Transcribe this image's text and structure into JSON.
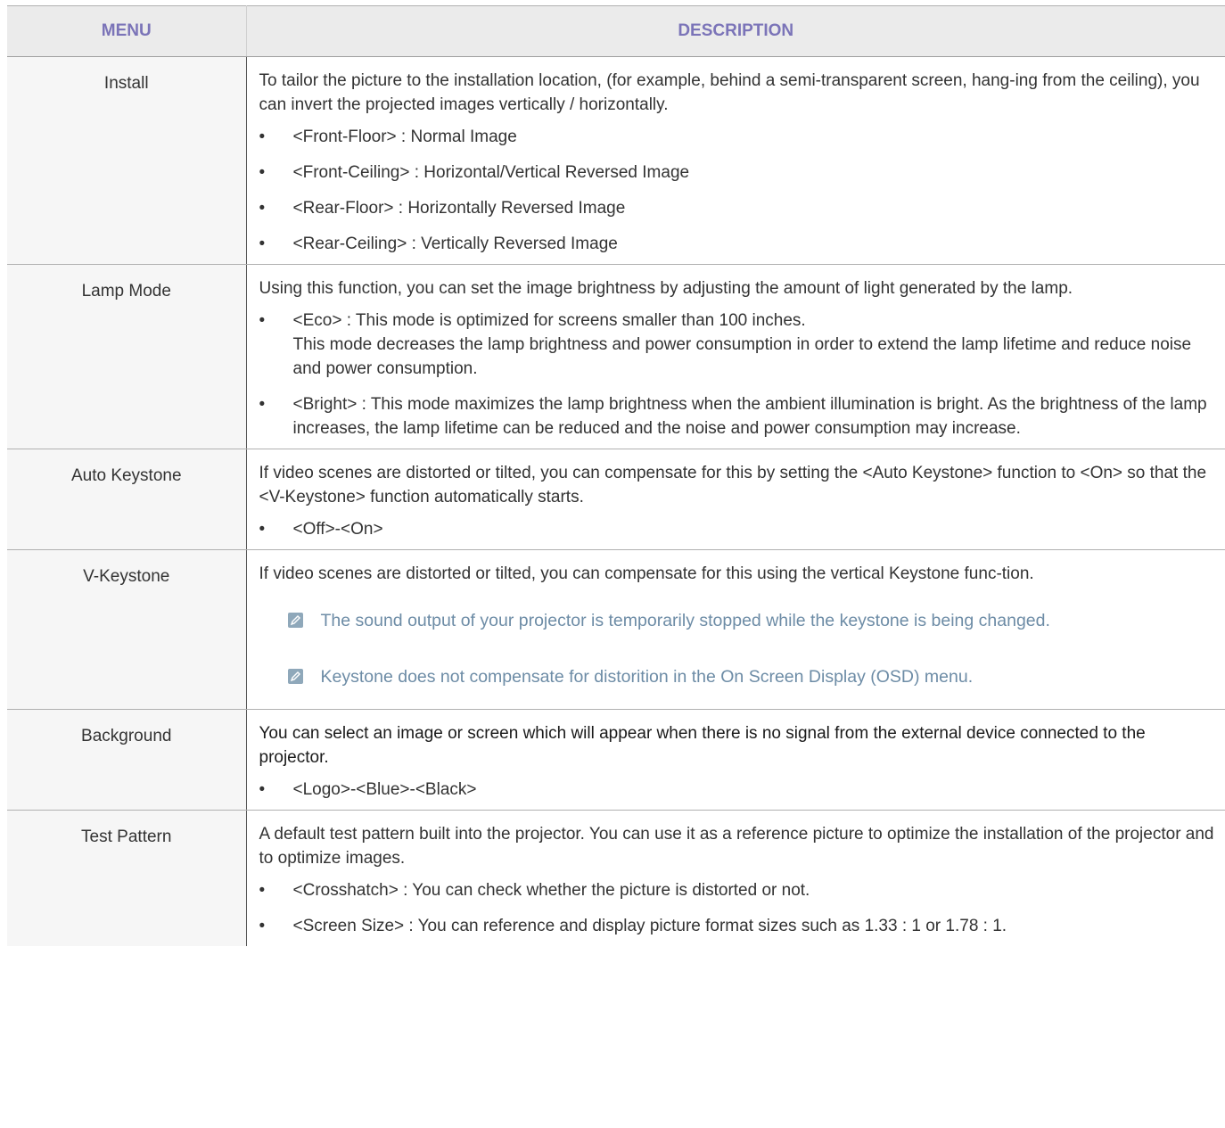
{
  "header": {
    "menu": "MENU",
    "description": "DESCRIPTION"
  },
  "rows": [
    {
      "menu": "Install",
      "description": "To tailor the picture to the installation location, (for example, behind a semi-transparent screen, hang-ing from the ceiling), you can invert the projected images vertically / horizontally.",
      "bullets": [
        "<Front-Floor> : Normal Image",
        "<Front-Ceiling> : Horizontal/Vertical Reversed Image",
        "<Rear-Floor> : Horizontally Reversed Image",
        "<Rear-Ceiling> : Vertically Reversed Image"
      ]
    },
    {
      "menu": "Lamp Mode",
      "description": "Using this function, you can set the image brightness by adjusting the amount of light generated by the lamp.",
      "bullets": [
        "<Eco> : This mode is optimized for screens smaller than 100 inches.",
        "<Bright> : This mode maximizes the lamp brightness when the ambient illumination is bright. As the brightness of the lamp increases, the lamp lifetime can be reduced and the noise and power consumption may increase."
      ],
      "eco_extra": "This mode decreases the lamp brightness and power consumption in order to extend the lamp lifetime and reduce noise and power consumption."
    },
    {
      "menu": "Auto Keystone",
      "description": "If video scenes are distorted or tilted, you can compensate for this by setting the <Auto Keystone> function to <On> so that the <V-Keystone> function automatically starts.",
      "bullets": [
        "<Off>-<On>"
      ]
    },
    {
      "menu": "V-Keystone",
      "description": "If video scenes are distorted or tilted, you can compensate for this using the vertical Keystone func-tion.",
      "notes": [
        "The sound output of your projector is temporarily stopped while the keystone is being changed.",
        "Keystone does not compensate for distorition in the On Screen Display (OSD) menu."
      ]
    },
    {
      "menu": "Background",
      "description": "You can select an image or screen which will appear when there is no signal from the external device connected to the projector.",
      "bullets": [
        "<Logo>-<Blue>-<Black>"
      ]
    },
    {
      "menu": "Test Pattern",
      "description": "A default test pattern built into the projector. You can use it as a reference picture to optimize the installation of the projector and to optimize images.",
      "bullets": [
        "<Crosshatch> : You can check whether the picture is distorted or not.",
        "<Screen Size> : You can reference and display picture format sizes such as 1.33 : 1 or 1.78 : 1."
      ]
    }
  ],
  "bullet_char": "•",
  "note_icon": "note-pencil-icon"
}
